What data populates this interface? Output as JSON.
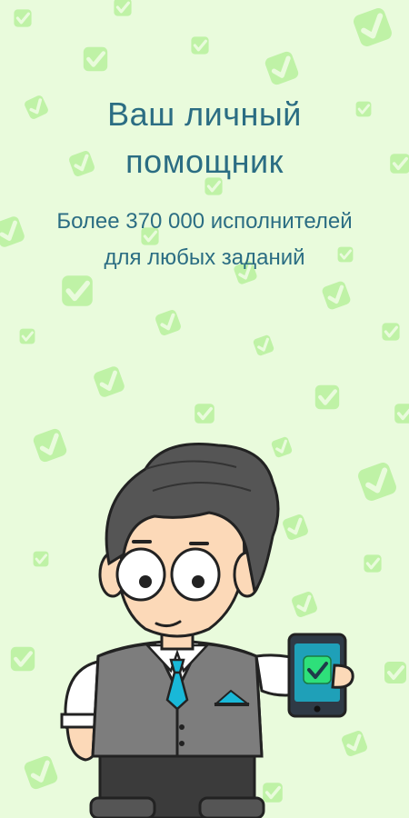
{
  "onboarding": {
    "headline_line1": "Ваш личный",
    "headline_line2": "помощник",
    "subtitle_line1": "Более 370 000 исполнителей",
    "subtitle_line2": "для любых заданий"
  },
  "background": {
    "color": "#e9fbdc",
    "pattern_icon": "checkmark-badge-icon",
    "pattern_color": "#b8f0a0"
  },
  "illustration": {
    "character": "mascot-man-with-phone",
    "phone_screen_icon": "checkmark-icon",
    "accent_color": "#2b6d83"
  }
}
